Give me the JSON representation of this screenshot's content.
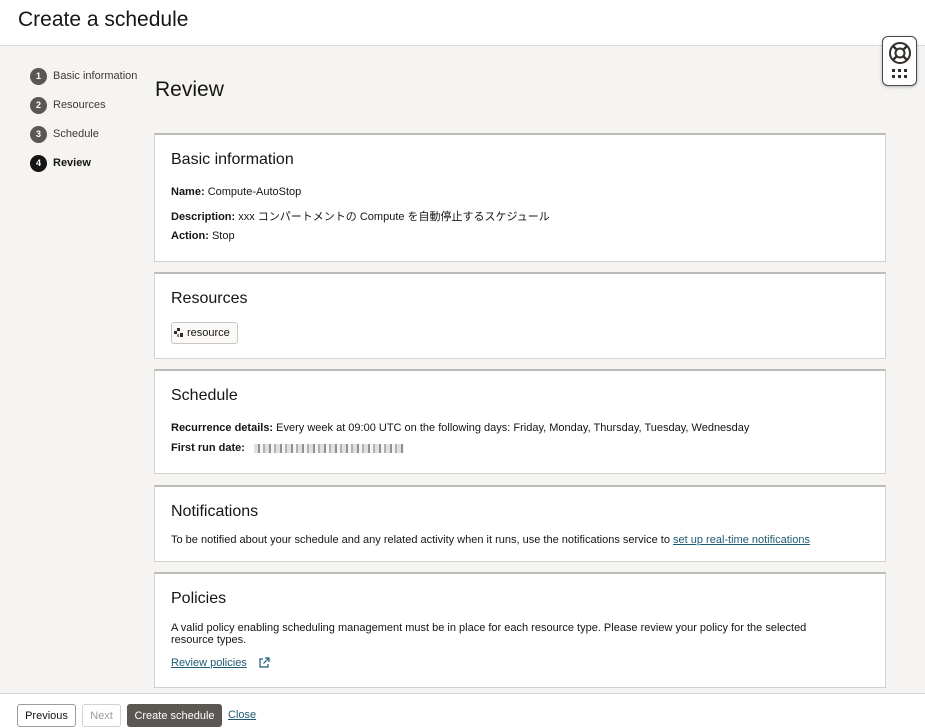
{
  "header": {
    "title": "Create a schedule"
  },
  "steps": [
    {
      "num": "1",
      "label": "Basic information",
      "active": false
    },
    {
      "num": "2",
      "label": "Resources",
      "active": false
    },
    {
      "num": "3",
      "label": "Schedule",
      "active": false
    },
    {
      "num": "4",
      "label": "Review",
      "active": true
    }
  ],
  "page_title": "Review",
  "basic_info": {
    "title": "Basic information",
    "name_label": "Name:",
    "name_value": "Compute-AutoStop",
    "description_label": "Description:",
    "description_value": "xxx コンパートメントの Compute を自動停止するスケジュール",
    "action_label": "Action:",
    "action_value": "Stop"
  },
  "resources": {
    "title": "Resources",
    "chip_label": "resource",
    "chip_icon": "resource-icon"
  },
  "schedule": {
    "title": "Schedule",
    "recurrence_label": "Recurrence details:",
    "recurrence_value": "Every week at 09:00 UTC on the following days: Friday, Monday, Thursday, Tuesday, Wednesday",
    "first_run_label": "First run date:"
  },
  "notifications": {
    "title": "Notifications",
    "text": "To be notified about your schedule and any related activity when it runs, use the notifications service to",
    "link": "set up real-time notifications"
  },
  "policies": {
    "title": "Policies",
    "text": "A valid policy enabling scheduling management must be in place for each resource type. Please review your policy for the selected resource types.",
    "link": "Review policies",
    "link_icon": "external-link-icon"
  },
  "footer": {
    "previous": "Previous",
    "next": "Next",
    "create": "Create schedule",
    "close": "Close"
  },
  "colors": {
    "primary_button": "#5b5752",
    "link": "#1e5b73",
    "step_active": "#161513"
  }
}
